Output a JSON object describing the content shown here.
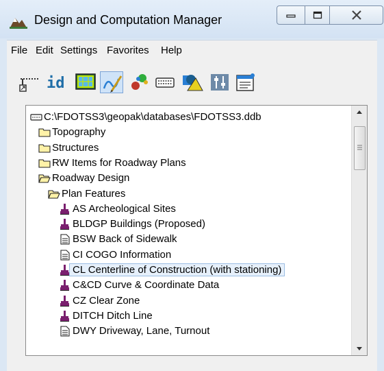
{
  "window": {
    "title": "Design and Computation Manager",
    "controls": [
      "minimize",
      "maximize",
      "close"
    ]
  },
  "menu": {
    "items": [
      {
        "label": "File"
      },
      {
        "label": "Edit"
      },
      {
        "label": "Settings"
      },
      {
        "label": "Favorites"
      },
      {
        "label": "Help"
      }
    ]
  },
  "toolbar": {
    "icons": [
      "element-selector-icon",
      "identify-id-icon",
      "display-mode-icon",
      "draw-mode-icon",
      "palette-icon",
      "keyboard-icon",
      "shapes-icon",
      "tools-icon",
      "settings-icon"
    ],
    "id_text": "id",
    "active_icon": "draw-mode-icon"
  },
  "tree": {
    "selected_index": 10,
    "rows": [
      {
        "level": 0,
        "icon": "database-icon",
        "label": "C:\\FDOTSS3\\geopak\\databases\\FDOTSS3.ddb"
      },
      {
        "level": 1,
        "icon": "folder-closed-icon",
        "label": "Topography"
      },
      {
        "level": 1,
        "icon": "folder-closed-icon",
        "label": "Structures"
      },
      {
        "level": 1,
        "icon": "folder-closed-icon",
        "label": "RW Items for Roadway Plans"
      },
      {
        "level": 1,
        "icon": "folder-open-icon",
        "label": "Roadway Design"
      },
      {
        "level": 2,
        "icon": "folder-open-icon",
        "label": "Plan Features"
      },
      {
        "level": 3,
        "icon": "paintbrush-icon",
        "label": "AS Archeological Sites"
      },
      {
        "level": 3,
        "icon": "paintbrush-icon",
        "label": "BLDGP Buildings (Proposed)"
      },
      {
        "level": 3,
        "icon": "document-icon",
        "label": "BSW Back of Sidewalk"
      },
      {
        "level": 3,
        "icon": "document-icon",
        "label": "CI COGO Information"
      },
      {
        "level": 3,
        "icon": "paintbrush-icon",
        "label": "CL Centerline of Construction (with stationing)"
      },
      {
        "level": 3,
        "icon": "paintbrush-icon",
        "label": "C&CD Curve & Coordinate Data"
      },
      {
        "level": 3,
        "icon": "paintbrush-icon",
        "label": "CZ Clear Zone"
      },
      {
        "level": 3,
        "icon": "paintbrush-icon",
        "label": "DITCH Ditch Line"
      },
      {
        "level": 3,
        "icon": "document-icon",
        "label": "DWY Driveway, Lane, Turnout"
      }
    ]
  },
  "colors": {
    "title_bg": "#dbe7f4",
    "selection_bg": "#e6f0fb",
    "selection_border": "#9bbde3",
    "folder_fill": "#fff2a8",
    "brush_color": "#7a1f6e"
  }
}
